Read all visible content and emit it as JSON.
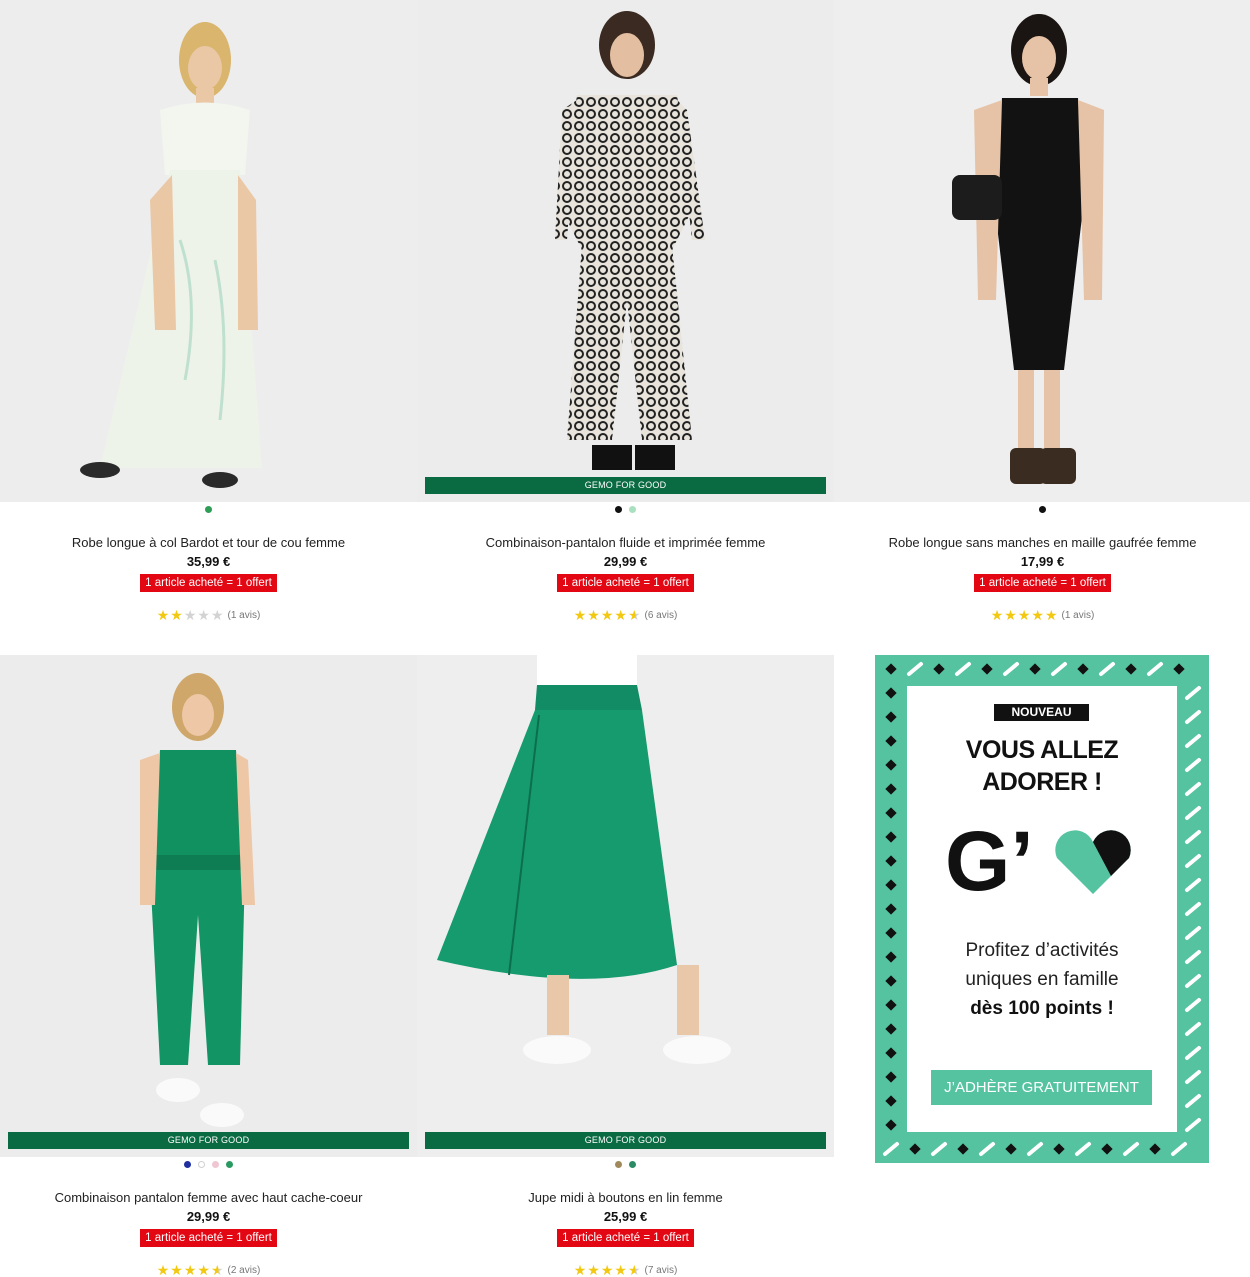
{
  "products": [
    {
      "name": "Robe longue à col Bardot et tour de cou femme",
      "price": "35,99 €",
      "promo": "1 article acheté = 1 offert",
      "rating": 2,
      "reviews": "(1 avis)",
      "badge": "",
      "swatches": [
        "#2e9e56"
      ]
    },
    {
      "name": "Combinaison-pantalon fluide et imprimée femme",
      "price": "29,99 €",
      "promo": "1 article acheté = 1 offert",
      "rating": 4.5,
      "reviews": "(6 avis)",
      "badge": "GEMO FOR GOOD",
      "swatches": [
        "#111111",
        "#a8e0c0"
      ]
    },
    {
      "name": "Robe longue sans manches en maille gaufrée femme",
      "price": "17,99 €",
      "promo": "1 article acheté = 1 offert",
      "rating": 5,
      "reviews": "(1 avis)",
      "badge": "",
      "swatches": [
        "#111111"
      ]
    },
    {
      "name": "Combinaison pantalon femme avec haut cache-coeur",
      "price": "29,99 €",
      "promo": "1 article acheté = 1 offert",
      "rating": 4.5,
      "reviews": "(2 avis)",
      "badge": "GEMO FOR GOOD",
      "swatches": [
        "#1f2fa0",
        "#ffffff",
        "#efc6d2",
        "#2a9a62"
      ]
    },
    {
      "name": "Jupe midi à boutons en lin femme",
      "price": "25,99 €",
      "promo": "1 article acheté = 1 offert",
      "rating": 4.5,
      "reviews": "(7 avis)",
      "badge": "GEMO FOR GOOD",
      "swatches": [
        "#a08a5c",
        "#2a8c66"
      ]
    }
  ],
  "promo_panel": {
    "tag": "NOUVEAU",
    "headline_line1": "VOUS ALLEZ",
    "headline_line2": "ADORER !",
    "logo_text": "G’",
    "body_line1": "Profitez d’activités",
    "body_line2": "uniques en famille",
    "body_line3": "dès 100 points !",
    "cta": "J’ADHÈRE GRATUITEMENT",
    "accent": "#56c3a0"
  },
  "colors": {
    "promo_red": "#e30613",
    "badge_green": "#0a6a42",
    "star": "#f2c811"
  }
}
